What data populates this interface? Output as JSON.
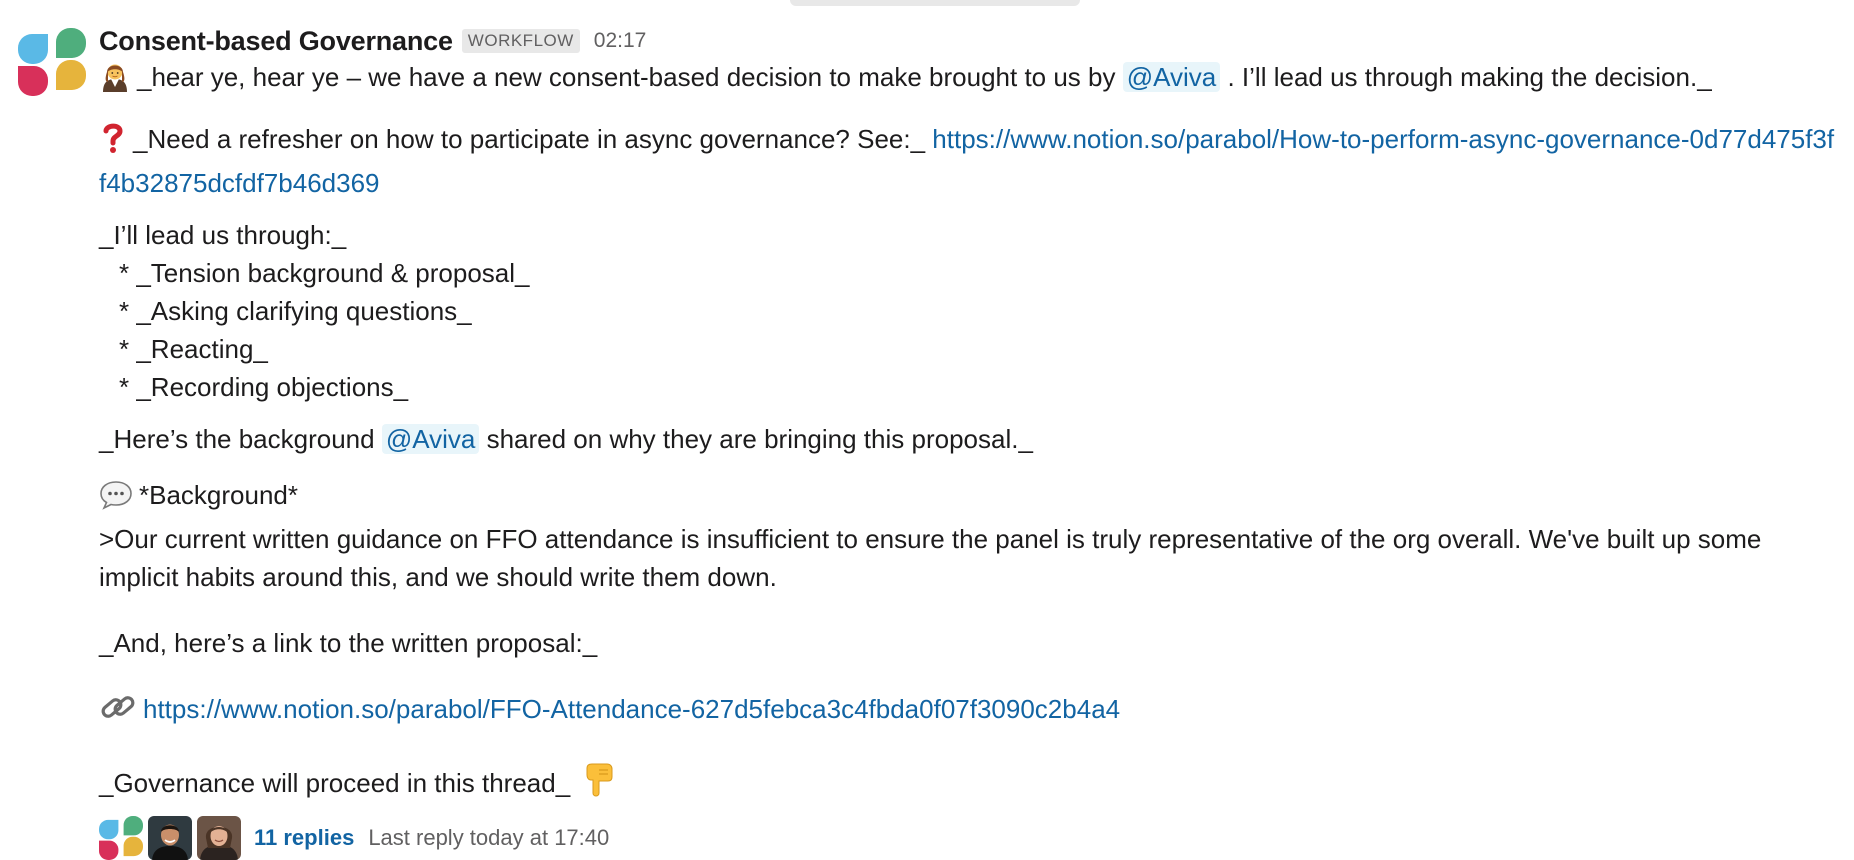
{
  "message": {
    "sender": "Consent-based Governance",
    "badge": "WORKFLOW",
    "time": "02:17",
    "intro_text": "_hear ye, hear ye – we have a new consent-based decision to make brought to us by",
    "intro_mention": "@Aviva",
    "intro_suffix": ". I’ll lead us through making the decision._",
    "refresher_text": "_Need a refresher on how to participate in async governance? See:_",
    "refresher_link": "https://www.notion.so/parabol/How-to-perform-async-governance-0d77d475f3ff4b32875dcfdf7b46d369",
    "steps_intro": "_I’ll lead us through:_",
    "steps": [
      "* _Tension background & proposal_",
      "* _Asking clarifying questions_",
      "* _Reacting_",
      "* _Recording objections_"
    ],
    "background_prefix": "_Here’s the background",
    "background_mention": "@Aviva",
    "background_suffix": "shared on why they are bringing this proposal._",
    "background_heading": "*Background*",
    "background_quote": ">Our current written guidance on FFO attendance is insufficient to ensure the panel is truly representative of the org overall. We've built up some implicit habits around this, and we should write them down.",
    "proposal_intro": "_And, here’s a link to the written proposal:_",
    "proposal_link": "https://www.notion.so/parabol/FFO-Attendance-627d5febca3c4fbda0f07f3090c2b4a4",
    "thread_note": "_Governance will proceed in this thread_"
  },
  "thread": {
    "reply_count": "11 replies",
    "last_reply": "Last reply today at 17:40"
  },
  "icons": {
    "intro_emoji": "judge-woman-icon",
    "refresher_emoji": "red-question-mark-icon",
    "background_emoji": "speech-balloon-icon",
    "proposal_emoji": "link-icon",
    "thread_emoji": "point-down-icon"
  },
  "colors": {
    "logo_blue": "#5ab9e6",
    "logo_green": "#4fae7d",
    "logo_red": "#d8305a",
    "logo_yellow": "#e6b43c",
    "link": "#1264a3",
    "mention_bg": "#e8f5fa"
  }
}
